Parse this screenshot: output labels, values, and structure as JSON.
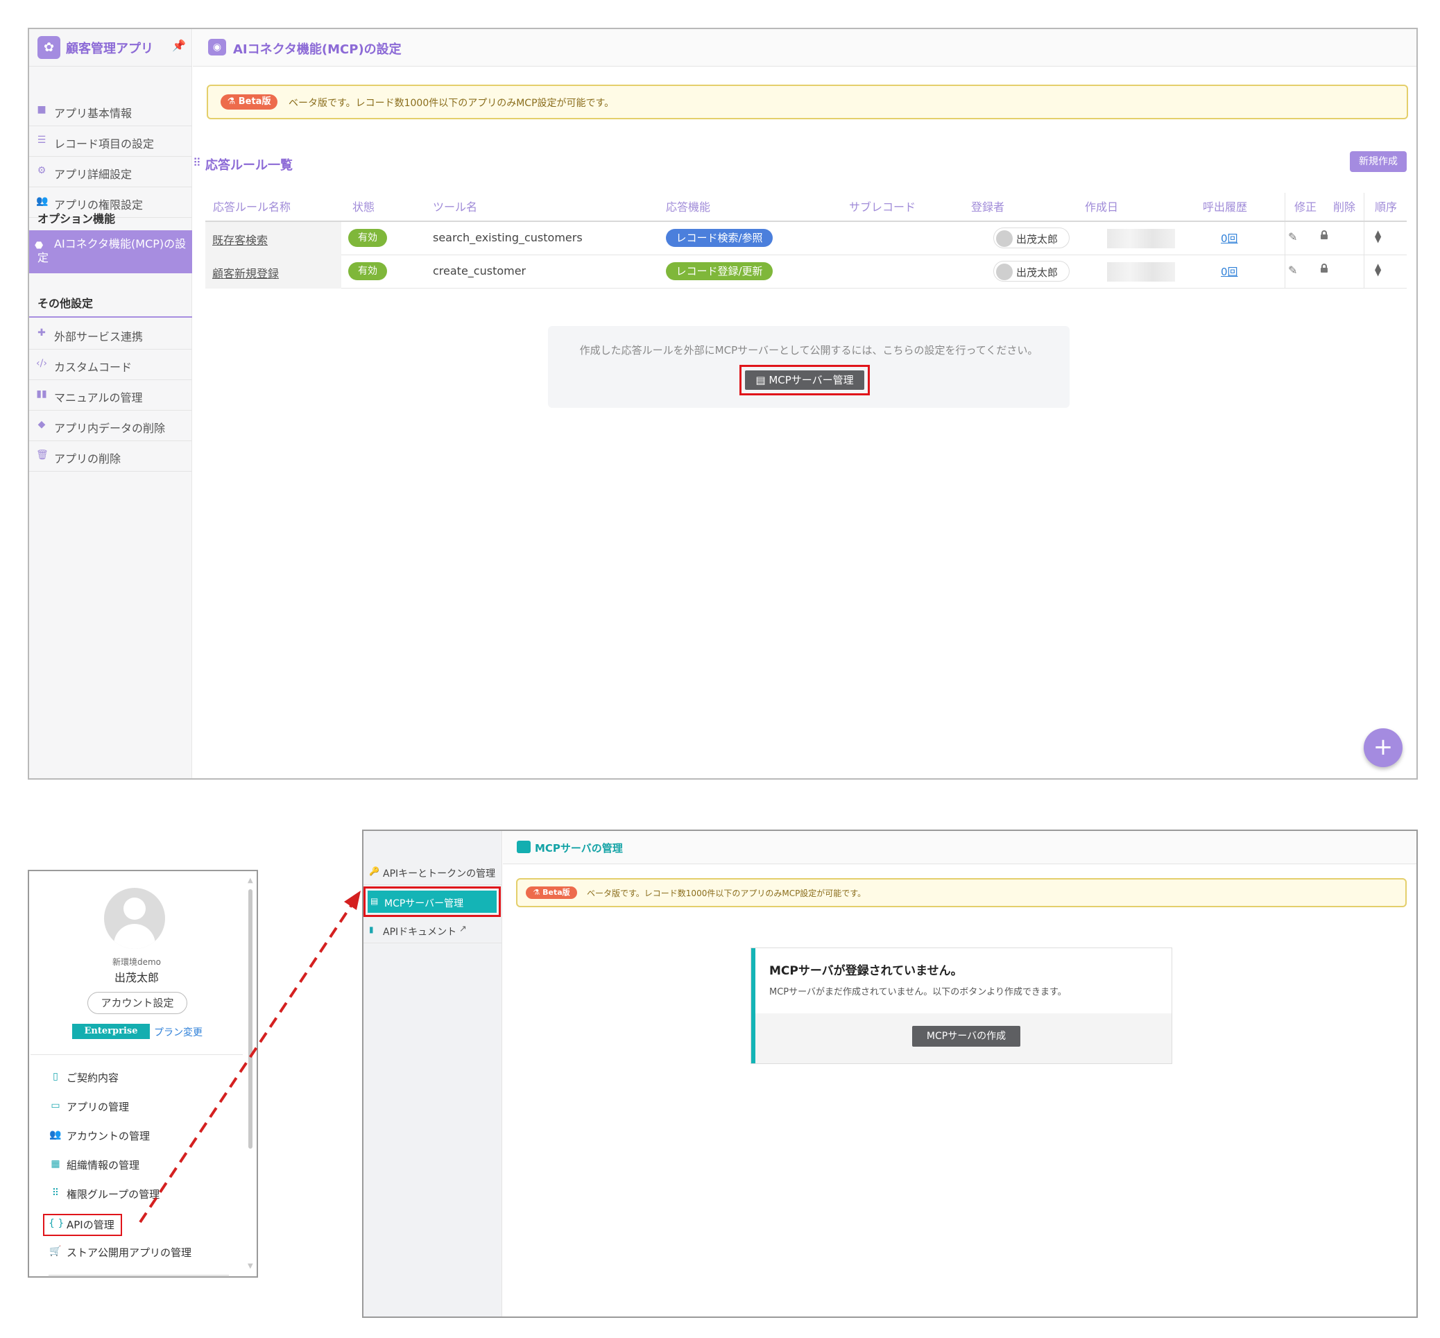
{
  "top_panel": {
    "app_title": "顧客管理アプリ",
    "page_title": "AIコネクタ機能(MCP)の設定",
    "sidebar": {
      "items": [
        {
          "icon": "info-icon",
          "label": "アプリ基本情報"
        },
        {
          "icon": "list-icon",
          "label": "レコード項目の設定"
        },
        {
          "icon": "gear-icon",
          "label": "アプリ詳細設定"
        },
        {
          "icon": "users-lock-icon",
          "label": "アプリの権限設定"
        }
      ],
      "option_heading": "オプション機能",
      "active_item": "AIコネクタ機能(MCP)の設定",
      "other_heading": "その他設定",
      "other_items": [
        {
          "icon": "puzzle-icon",
          "label": "外部サービス連携"
        },
        {
          "icon": "code-icon",
          "label": "カスタムコード"
        },
        {
          "icon": "book-icon",
          "label": "マニュアルの管理"
        },
        {
          "icon": "eraser-icon",
          "label": "アプリ内データの削除"
        },
        {
          "icon": "trash-icon",
          "label": "アプリの削除"
        }
      ]
    },
    "beta_badge": "Beta版",
    "beta_text": "ベータ版です。レコード数1000件以下のアプリのみMCP設定が可能です。",
    "rules_title": "応答ルール一覧",
    "new_button": "新規作成",
    "table_headers": [
      "応答ルール名称",
      "状態",
      "ツール名",
      "応答機能",
      "サブレコード",
      "登録者",
      "作成日",
      "呼出履歴",
      "修正",
      "削除",
      "順序"
    ],
    "rows": [
      {
        "name": "既存客検索",
        "status": "有効",
        "tool": "search_existing_customers",
        "function": "レコード検索/参照",
        "function_color": "#4b7fdc",
        "registrant": "出茂太郎",
        "history": "0回"
      },
      {
        "name": "顧客新規登録",
        "status": "有効",
        "tool": "create_customer",
        "function": "レコード登録/更新",
        "function_color": "#7fb73a",
        "registrant": "出茂太郎",
        "history": "0回"
      }
    ],
    "mcp_notice": "作成した応答ルールを外部にMCPサーバーとして公開するには、こちらの設定を行ってください。",
    "mcp_button": "MCPサーバー管理",
    "fab_label": "+"
  },
  "account_panel": {
    "env_name": "新環境demo",
    "user_name": "出茂太郎",
    "account_button": "アカウント設定",
    "plan_badge": "Enterprise",
    "plan_link": "プラン変更",
    "menu": [
      {
        "icon": "contract-icon",
        "label": "ご契約内容"
      },
      {
        "icon": "window-icon",
        "label": "アプリの管理"
      },
      {
        "icon": "users-icon",
        "label": "アカウントの管理"
      },
      {
        "icon": "building-icon",
        "label": "組織情報の管理"
      },
      {
        "icon": "group-icon",
        "label": "権限グループの管理"
      },
      {
        "icon": "braces-icon",
        "label": "APIの管理"
      },
      {
        "icon": "cart-icon",
        "label": "ストア公開用アプリの管理"
      }
    ]
  },
  "mcp_panel": {
    "title": "MCPサーバの管理",
    "sidebar": [
      {
        "icon": "key-icon",
        "label": "APIキーとトークンの管理"
      },
      {
        "icon": "server-icon",
        "label": "MCPサーバー管理"
      },
      {
        "icon": "document-icon",
        "label": "APIドキュメント"
      }
    ],
    "beta_badge": "Beta版",
    "beta_text": "ベータ版です。レコード数1000件以下のアプリのみMCP設定が可能です。",
    "empty_title": "MCPサーバが登録されていません。",
    "empty_desc": "MCPサーバがまだ作成されていません。以下のボタンより作成できます。",
    "create_button": "MCPサーバの作成"
  },
  "colors": {
    "accent_purple": "#a48be0",
    "accent_teal": "#14b4b6",
    "highlight_red": "#e0141a",
    "status_green": "#7fb73a"
  }
}
